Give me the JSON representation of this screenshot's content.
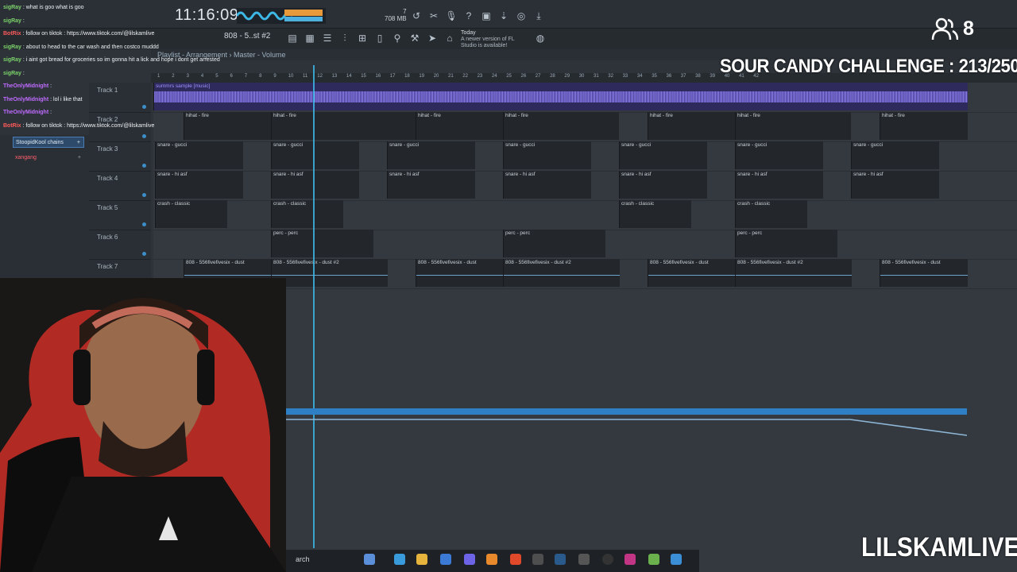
{
  "toolbar": {
    "clock": "11:16:09",
    "cpu_mem": "708 MB",
    "cpu_val": "7",
    "pattern": "808 - 5..st #2",
    "news_title": "Today",
    "news_text": "A newer version of FL Studio is available!"
  },
  "playlist": {
    "breadcrumb": "Playlist - Arrangement › Master - Volume",
    "ruler_ticks": [
      "1",
      "2",
      "3",
      "4",
      "5",
      "6",
      "7",
      "8",
      "9",
      "10",
      "11",
      "12",
      "13",
      "14",
      "15",
      "16",
      "17",
      "18",
      "19",
      "20",
      "21",
      "22",
      "23",
      "24",
      "25",
      "26",
      "27",
      "28",
      "29",
      "30",
      "31",
      "32",
      "33",
      "34",
      "35",
      "36",
      "37",
      "38",
      "39",
      "40",
      "41",
      "42"
    ],
    "tracks": [
      {
        "name": "Track 1"
      },
      {
        "name": "Track 2"
      },
      {
        "name": "Track 3"
      },
      {
        "name": "Track 4"
      },
      {
        "name": "Track 5"
      },
      {
        "name": "Track 6"
      },
      {
        "name": "Track 7"
      }
    ],
    "clip_labels": {
      "audio": "summrs sample [music]",
      "hihat": "hihat - fire",
      "snare": "snare - gucci",
      "snare2": "snare - hi asf",
      "crash": "crash - classic",
      "perc": "perc - perc",
      "b808": "808 - 556fivefivesix - dust",
      "b808b": "808 - 556fivefivesix - dust #2"
    }
  },
  "chat": [
    {
      "user": "sigRay",
      "text": ": what is goo what is goo",
      "color": "#7cd36b"
    },
    {
      "user": "sigRay",
      "text": ":",
      "color": "#7cd36b"
    },
    {
      "user": "BotRix",
      "text": ": follow on tiktok : https://www.tiktok.com/@lilskamlive",
      "color": "#ff5a5a"
    },
    {
      "user": "sigRay",
      "text": ": about to head to the car wash and then costco muddd",
      "color": "#7cd36b"
    },
    {
      "user": "sigRay",
      "text": ": i aint got bread for groceries so im gonna hit a lick and hope i dont get arrested",
      "color": "#7cd36b"
    },
    {
      "user": "sigRay",
      "text": ":",
      "color": "#7cd36b"
    },
    {
      "user": "TheOnlyMidnight",
      "text": ":",
      "color": "#c06bff"
    },
    {
      "user": "TheOnlyMidnight",
      "text": ": lol i like that",
      "color": "#c06bff"
    },
    {
      "user": "TheOnlyMidnight",
      "text": ":",
      "color": "#c06bff"
    },
    {
      "user": "BotRix",
      "text": ": follow on tiktok : https://www.tiktok.com/@lilskamlive",
      "color": "#ff5a5a"
    }
  ],
  "side_panel": [
    {
      "label": "StoopidKool chains"
    },
    {
      "label": "xangang"
    }
  ],
  "overlay": {
    "viewers": "8",
    "challenge": "SOUR CANDY CHALLENGE : 213/250",
    "brand": "LILSKAMLIVE"
  },
  "taskbar": {
    "search": "arch"
  },
  "colors": {
    "accent": "#3db7e6",
    "audio_clip": "#7d6fd6",
    "automation": "#2f7fc4"
  }
}
